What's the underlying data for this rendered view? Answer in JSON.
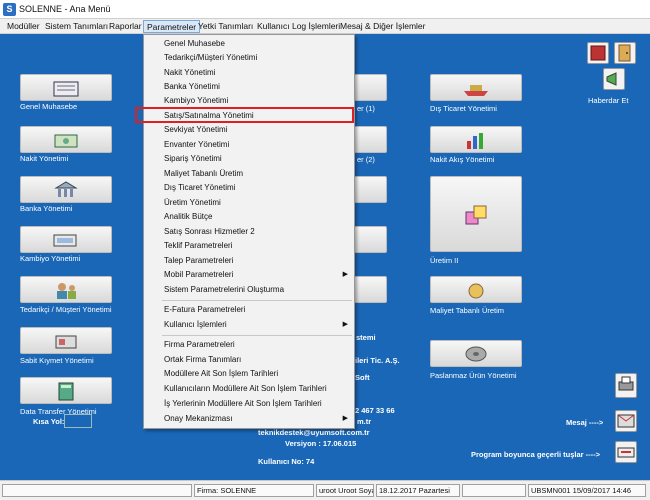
{
  "window": {
    "title": "SOLENNE - Ana Menü"
  },
  "menubar": [
    "Modüller",
    "Sistem Tanımları",
    "Raporlar",
    "Parametreler",
    "Yetki Tanımları",
    "Kullanıcı Log İşlemleri",
    "Mesaj & Diğer İşlemler"
  ],
  "dropdown": {
    "items": [
      "Genel Muhasebe",
      "Tedarikçi/Müşteri Yönetimi",
      "Nakit Yönetimi",
      "Banka Yönetimi",
      "Kambiyo Yönetimi",
      "Satış/Satınalma Yönetimi",
      "Sevkiyat Yönetimi",
      "Envanter Yönetimi",
      "Sipariş Yönetimi",
      "Maliyet Tabanlı Üretim",
      "Dış Ticaret Yönetimi",
      "Üretim Yönetimi",
      "Analitik Bütçe",
      "Satış Sonrası Hizmetler 2",
      "Teklif Parametreleri",
      "Talep Parametreleri",
      "Mobil Parametreleri",
      "Sistem Parametrelerini Oluşturma",
      "E-Fatura Parametreleri",
      "Kullanıcı İşlemleri",
      "Firma Parametreleri",
      "Ortak Firma Tanımları",
      "Modüllere Ait Son İşlem Tarihleri",
      "Kullanıcıların Modüllere Ait Son İşlem Tarihleri",
      "İş Yerlerinin Modüllere Ait Son İşlem Tarihleri",
      "Onay Mekanizması"
    ]
  },
  "left_tiles": [
    "Genel Muhasebe",
    "Nakit Yönetimi",
    "Banka Yönetimi",
    "Kambiyo Yönetimi",
    "Tedarikçi / Müşteri Yönetimi",
    "Sabit Kıymet Yönetimi",
    "Data Transfer Yönetimi"
  ],
  "middle_fragments": [
    "er (1)",
    "er (2)"
  ],
  "right_tiles": [
    "Dış Ticaret Yönetimi",
    "Nakit Akış Yönetimi",
    "Üretim II",
    "Maliyet Tabanlı Üretim",
    "Paslanmaz Ürün Yönetimi"
  ],
  "side": {
    "haberdar": "Haberdar Et"
  },
  "info": {
    "line1": "stemi",
    "line2": "ileri Tic. A.Ş.",
    "line3": "Soft",
    "phone": "2 467 33 66",
    "web": "m.tr",
    "email": "teknikdestek@uyumsoft.com.tr",
    "version": "Versiyon  : 17.06.015",
    "user_no": "Kullanıcı No:  74"
  },
  "messages": {
    "mesaj": "Mesaj  ---->",
    "keys": "Program boyunca geçerli tuşlar  ---->"
  },
  "kisa_yol": "Kısa Yol:",
  "status": {
    "firma": "Firma: SOLENNE",
    "user": "uroot Uroot Soyadı",
    "date": "18.12.2017  Pazartesi",
    "form": "UBSMN001 15/09/2017 14:46"
  }
}
